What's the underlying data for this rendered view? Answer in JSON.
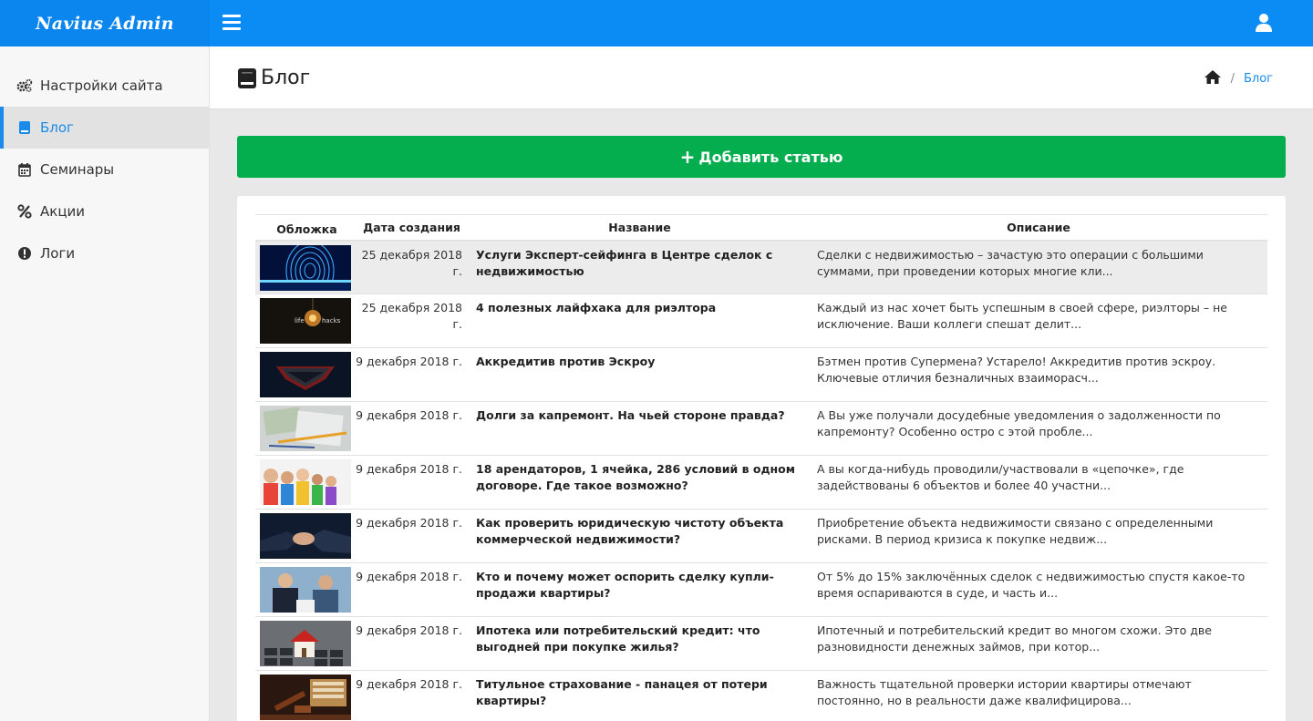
{
  "app": {
    "brand": "Navius Admin"
  },
  "sidebar": {
    "items": [
      {
        "label": "Настройки сайта",
        "icon": "cogs-icon"
      },
      {
        "label": "Блог",
        "icon": "book-icon",
        "active": true
      },
      {
        "label": "Семинары",
        "icon": "calendar-icon"
      },
      {
        "label": "Акции",
        "icon": "percent-icon"
      },
      {
        "label": "Логи",
        "icon": "exclamation-circle-icon"
      }
    ]
  },
  "header": {
    "title": "Блог",
    "breadcrumb_current": "Блог",
    "breadcrumb_sep": "/"
  },
  "actions": {
    "add_label": "Добавить статью",
    "add_plus": "+"
  },
  "table": {
    "headers": {
      "cover": "Обложка",
      "date": "Дата создания",
      "name": "Название",
      "desc": "Описание"
    },
    "rows": [
      {
        "date": "25 декабря 2018 г.",
        "name": "Услуги Эксперт-сейфинга в Центре сделок с недвижимостью",
        "desc": "Сделки с недвижимостью – зачастую это операции с большими суммами, при проведении которых многие кли..."
      },
      {
        "date": "25 декабря 2018 г.",
        "name": "4 полезных лайфхака для риэлтора",
        "desc": "Каждый из нас хочет быть успешным в своей сфере, риэлторы – не исключение. Ваши коллеги спешат делит..."
      },
      {
        "date": "9 декабря 2018 г.",
        "name": "Аккредитив против Эскроу",
        "desc": "Бэтмен против Супермена? Устарело! Аккредитив против эскроу. Ключевые отличия безналичных взаиморасч..."
      },
      {
        "date": "9 декабря 2018 г.",
        "name": "Долги за капремонт. На чьей стороне правда?",
        "desc": "А Вы уже получали досудебные уведомления о задолженности по капремонту? Особенно остро с этой пробле..."
      },
      {
        "date": "9 декабря 2018 г.",
        "name": "18 арендаторов, 1 ячейка, 286 условий в одном договоре. Где такое возможно?",
        "desc": "А вы когда-нибудь проводили/участвовали в «цепочке», где задействованы 6 объектов и более 40 участни..."
      },
      {
        "date": "9 декабря 2018 г.",
        "name": "Как проверить юридическую чистоту объекта коммерческой недвижимости?",
        "desc": "Приобретение объекта недвижимости связано с определенными рисками. В период кризиса к покупке недвиж..."
      },
      {
        "date": "9 декабря 2018 г.",
        "name": "Кто и почему может оспорить сделку купли-продажи квартиры?",
        "desc": "От 5% до 15% заключённых сделок с недвижимостью спустя какое-то время оспариваются в суде, и часть и..."
      },
      {
        "date": "9 декабря 2018 г.",
        "name": "Ипотека или потребительский кредит: что выгодней при покупке жилья?",
        "desc": "Ипотечный и потребительский кредит во многом схожи. Это две разновидности денежных займов, при котор..."
      },
      {
        "date": "9 декабря 2018 г.",
        "name": "Титульное страхование - панацея от потери квартиры?",
        "desc": "Важность тщательной проверки истории квартиры отмечают постоянно, но в реальности даже квалифицирова..."
      }
    ]
  },
  "thumb_texts": {
    "life": "life",
    "hacks": "hacks"
  },
  "colors": {
    "primary": "#0b8cf5",
    "success": "#04ad4d",
    "active_nav": "#1a8be8"
  }
}
